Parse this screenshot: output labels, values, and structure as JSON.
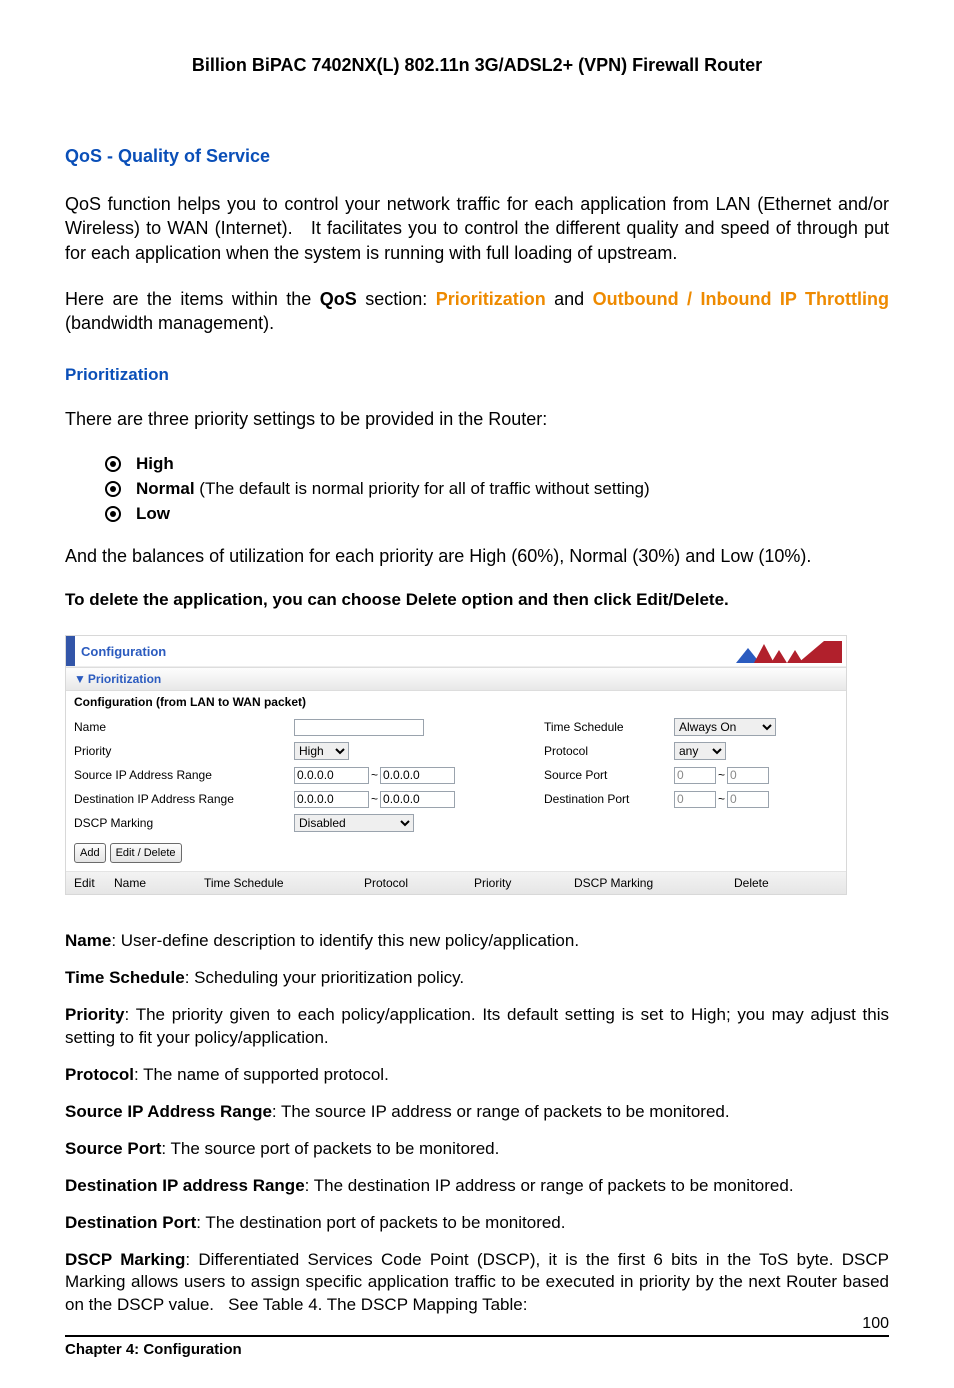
{
  "header": "Billion BiPAC 7402NX(L) 802.11n 3G/ADSL2+ (VPN) Firewall Router",
  "section_title": "QoS - Quality of Service",
  "para1": "QoS function helps you to control your network traffic for each application from LAN (Ethernet and/or Wireless) to WAN (Internet).   It facilitates you to control the different quality and speed of through put for each application when the system is running with full loading of upstream.",
  "para2_prefix": "Here are the items within the ",
  "para2_qos": "QoS",
  "para2_mid": " section: ",
  "para2_link1": "Prioritization",
  "para2_and": " and ",
  "para2_link2": "Outbound / Inbound IP Throttling",
  "para2_suffix": " (bandwidth management).",
  "sub1": "Prioritization",
  "para3": "There are three priority settings to be provided in the Router:",
  "bullets": [
    {
      "bold": "High",
      "rest": ""
    },
    {
      "bold": "Normal",
      "rest": " (The default is normal priority for all of traffic without setting)"
    },
    {
      "bold": "Low",
      "rest": ""
    }
  ],
  "para4": "And the balances of utilization for each priority are High (60%), Normal (30%) and Low (10%).",
  "bold_line": "To delete the application, you can choose Delete option and then click Edit/Delete.",
  "screenshot": {
    "panel_title": "Configuration",
    "section": "Prioritization",
    "subheading": "Configuration (from LAN to WAN packet)",
    "rows": {
      "name_label": "Name",
      "name_value": "",
      "time_label": "Time Schedule",
      "time_value": "Always On",
      "priority_label": "Priority",
      "priority_value": "High",
      "protocol_label": "Protocol",
      "protocol_value": "any",
      "srcip_label": "Source IP Address Range",
      "srcip_from": "0.0.0.0",
      "srcip_to": "0.0.0.0",
      "srcport_label": "Source Port",
      "srcport_from": "0",
      "srcport_to": "0",
      "dstip_label": "Destination IP Address Range",
      "dstip_from": "0.0.0.0",
      "dstip_to": "0.0.0.0",
      "dstport_label": "Destination Port",
      "dstport_from": "0",
      "dstport_to": "0",
      "dscp_label": "DSCP Marking",
      "dscp_value": "Disabled"
    },
    "buttons": {
      "add": "Add",
      "editdel": "Edit / Delete"
    },
    "table": {
      "c1": "Edit",
      "c2": "Name",
      "c3": "Time Schedule",
      "c4": "Protocol",
      "c5": "Priority",
      "c6": "DSCP Marking",
      "c7": "Delete"
    }
  },
  "defs": [
    {
      "term": "Name",
      "text": ": User-define description to identify this new policy/application."
    },
    {
      "term": "Time Schedule",
      "text": ": Scheduling your prioritization policy."
    },
    {
      "term": "Priority",
      "text": ": The priority given to each policy/application. Its default setting is set to High; you may adjust this setting to fit your policy/application."
    },
    {
      "term": "Protocol",
      "text": ": The name of supported protocol."
    },
    {
      "term": "Source IP Address Range",
      "text": ": The source IP address or range of packets to be monitored."
    },
    {
      "term": "Source Port",
      "text": ": The source port of packets to be monitored."
    },
    {
      "term": "Destination IP address Range",
      "text": ": The destination IP address or range of packets to be monitored."
    },
    {
      "term": "Destination Port",
      "text": ": The destination port of packets to be monitored."
    },
    {
      "term": "DSCP Marking",
      "text": ": Differentiated Services Code Point (DSCP), it is the first 6 bits in the ToS byte. DSCP Marking allows users to assign specific application traffic to be executed in priority by the next Router based on the DSCP value.   See Table 4. The DSCP Mapping Table:"
    }
  ],
  "footer": {
    "chapter": "Chapter 4: Configuration",
    "page": "100"
  }
}
